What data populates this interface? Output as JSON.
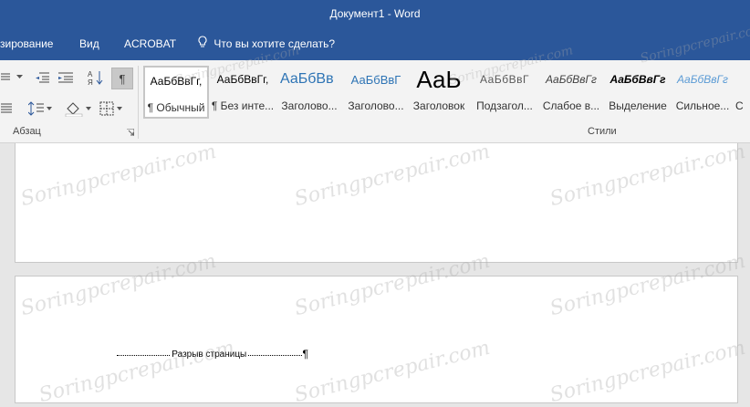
{
  "window": {
    "title": "Документ1 - Word"
  },
  "tabs": [
    {
      "label": "зирование"
    },
    {
      "label": "Вид"
    },
    {
      "label": "ACROBAT"
    }
  ],
  "tell_me": {
    "placeholder": "Что вы хотите сделать?"
  },
  "ribbon": {
    "paragraph_group": {
      "label": "Абзац"
    },
    "styles_group": {
      "label": "Стили"
    },
    "styles": [
      {
        "sample": "АаБбВвГг,",
        "name": "¶ Обычный",
        "active": true
      },
      {
        "sample": "АаБбВвГг,",
        "name": "¶ Без инте...",
        "active": false
      },
      {
        "sample": "АаБбВв",
        "name": "Заголово...",
        "active": false
      },
      {
        "sample": "АаБбВвГ",
        "name": "Заголово...",
        "active": false
      },
      {
        "sample": "АаЬ",
        "name": "Заголовок",
        "active": false
      },
      {
        "sample": "АаБбВвГ",
        "name": "Подзагол...",
        "active": false
      },
      {
        "sample": "АаБбВвГг",
        "name": "Слабое в...",
        "active": false
      },
      {
        "sample": "АаБбВвГг",
        "name": "Выделение",
        "active": false
      },
      {
        "sample": "АаБбВвГг",
        "name": "Сильное...",
        "active": false
      },
      {
        "sample": "",
        "name": "С",
        "active": false
      }
    ]
  },
  "document": {
    "page_break_label": "Разрыв страницы",
    "pilcrow": "¶"
  },
  "watermark": {
    "text": "Soringpcrepair.com"
  },
  "colors": {
    "accent": "#2b579a",
    "ribbon_bg": "#f3f3f3"
  }
}
